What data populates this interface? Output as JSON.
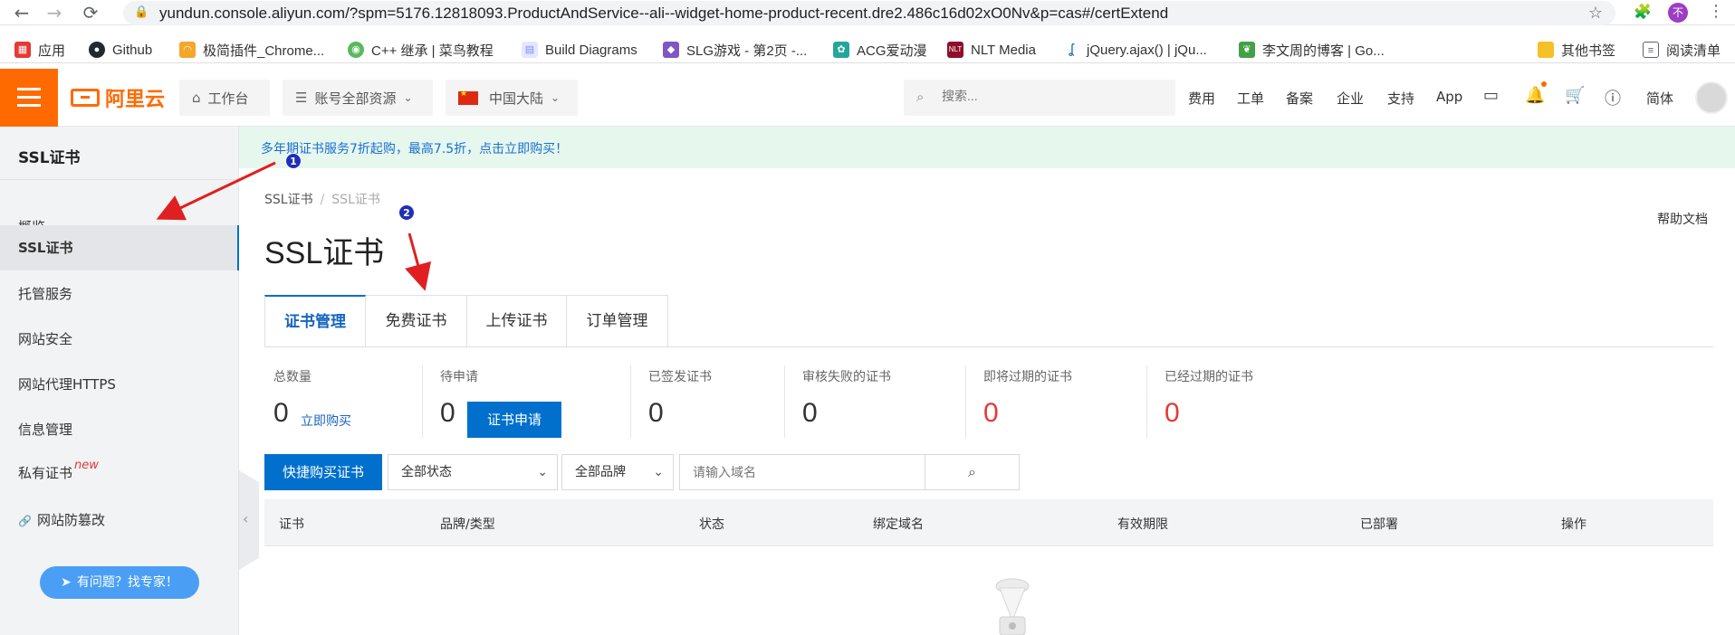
{
  "browser": {
    "url": "yundun.console.aliyun.com/?spm=5176.12818093.ProductAndService--ali--widget-home-product-recent.dre2.486c16d02xO0Nv&p=cas#/certExtend",
    "profile_initial": "不",
    "bookmarks": [
      {
        "label": "应用",
        "icon_color": "#e53935"
      },
      {
        "label": "Github",
        "icon_color": "#24292e"
      },
      {
        "label": "极简插件_Chrome...",
        "icon_color": "#f4a72a"
      },
      {
        "label": "C++ 继承 | 菜鸟教程",
        "icon_color": "#5cb85c"
      },
      {
        "label": "Build Diagrams",
        "icon_color": "#7b8cff"
      },
      {
        "label": "SLG游戏 - 第2页 -...",
        "icon_color": "#7e57c2"
      },
      {
        "label": "ACG爱动漫",
        "icon_color": "#26a69a"
      },
      {
        "label": "NLT Media",
        "icon_color": "#8e0e2b"
      },
      {
        "label": "jQuery.ajax() | jQu...",
        "icon_color": "#0769ad"
      },
      {
        "label": "李文周的博客 | Go...",
        "icon_color": "#43a047"
      },
      {
        "label": "其他书签",
        "icon_color": "#f6c026"
      },
      {
        "label": "阅读清单",
        "icon_color": "#5f6368"
      }
    ]
  },
  "topbar": {
    "logo_text": "阿里云",
    "workbench": "工作台",
    "resources": "账号全部资源",
    "region": "中国大陆",
    "search_placeholder": "搜索...",
    "links": [
      "费用",
      "工单",
      "备案",
      "企业",
      "支持",
      "App"
    ],
    "lang": "简体"
  },
  "sidebar": {
    "title": "SSL证书",
    "items": [
      {
        "label": "概览"
      },
      {
        "label": "SSL证书"
      },
      {
        "label": "托管服务"
      },
      {
        "label": "网站安全"
      },
      {
        "label": "网站代理HTTPS"
      },
      {
        "label": "信息管理"
      },
      {
        "label": "私有证书"
      },
      {
        "label": "网站防篡改"
      }
    ],
    "new_badge": "new",
    "expert_button": "有问题？找专家！"
  },
  "banner": "多年期证书服务7折起购，最高7.5折，点击立即购买！",
  "breadcrumb": [
    "SSL证书",
    "SSL证书"
  ],
  "help_doc": "帮助文档",
  "page_title": "SSL证书",
  "tabs": [
    "证书管理",
    "免费证书",
    "上传证书",
    "订单管理"
  ],
  "stats": [
    {
      "label": "总数量",
      "value": "0"
    },
    {
      "label": "待申请",
      "value": "0"
    },
    {
      "label": "已签发证书",
      "value": "0"
    },
    {
      "label": "审核失败的证书",
      "value": "0"
    },
    {
      "label": "即将过期的证书",
      "value": "0"
    },
    {
      "label": "已经过期的证书",
      "value": "0"
    }
  ],
  "buy_now": "立即购买",
  "apply_button": "证书申请",
  "toolbar": {
    "quick_buy": "快捷购买证书",
    "status_select": "全部状态",
    "brand_select": "全部品牌",
    "domain_placeholder": "请输入域名"
  },
  "table": {
    "headers": [
      "证书",
      "品牌/类型",
      "状态",
      "绑定域名",
      "有效期限",
      "已部署",
      "操作"
    ]
  },
  "annotations": [
    "1",
    "2"
  ],
  "colors": {
    "brand": "#ff6a00",
    "primary": "#0070cc",
    "danger": "#e53935",
    "arrow": "#e02020"
  }
}
